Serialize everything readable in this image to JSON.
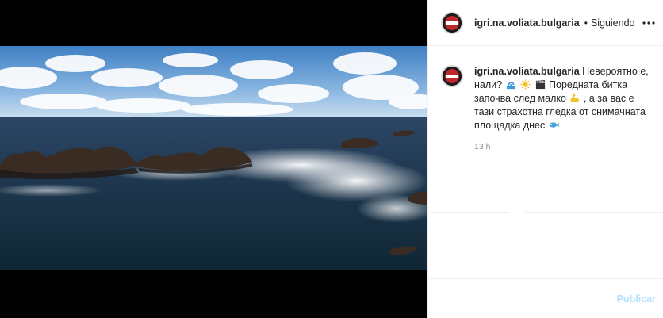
{
  "post": {
    "username": "igri.na.voliata.bulgaria",
    "dot": "•",
    "follow_label": "Siguiendo",
    "more_icon": "more-horizontal-icon",
    "caption": {
      "part1": "Невероятно е, нали?",
      "part2": "Поредната битка започва след малко",
      "part3": ", а за вас е тази страхотна гледка от снимачната площадка днес"
    },
    "emojis": [
      "wave-icon",
      "sun-icon",
      "clapperboard-icon",
      "flexed-biceps-icon",
      "fish-icon"
    ],
    "timestamp": "13 h"
  },
  "composer": {
    "placeholder": "",
    "publish_label": "Publicar"
  },
  "colors": {
    "text": "#262626",
    "muted": "#8e8e8e",
    "publish_disabled": "#b2dffc",
    "media_bg": "#000000",
    "border": "#efefef"
  }
}
